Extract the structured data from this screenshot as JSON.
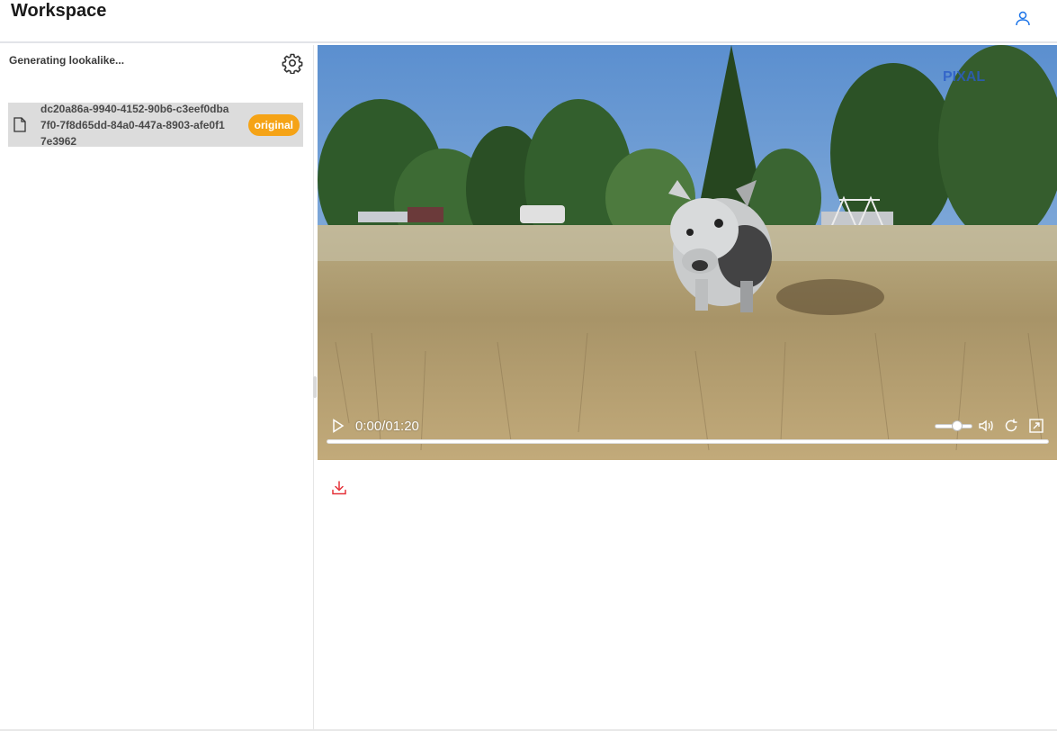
{
  "header": {
    "title": "Workspace",
    "user_icon": "user-icon"
  },
  "sidebar": {
    "status": "Generating lookalike...",
    "settings_icon": "gear-icon",
    "files": [
      {
        "name": "dc20a86a-9940-4152-90b6-c3eef0dba7f0-7f8d65dd-84a0-447a-8903-afe0f17e3962",
        "badge": "original",
        "icon": "file-icon"
      }
    ]
  },
  "player": {
    "time": "0:00/01:20",
    "progress": 0,
    "volume": 0.6,
    "icons": [
      "play-icon",
      "volume-icon",
      "replay-icon",
      "fullscreen-icon"
    ]
  },
  "actions": {
    "download_icon": "download-icon"
  },
  "colors": {
    "accent": "#1a73e8",
    "badge": "#f5a316",
    "download": "#e5333a"
  }
}
